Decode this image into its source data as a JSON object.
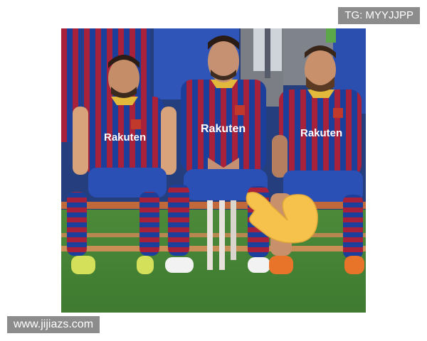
{
  "watermark_top": "TG: MYYJJPP",
  "watermark_bottom": "www.jijiazs.com",
  "sponsor": "Rakuten",
  "colors": {
    "kit_blue": "#1d3f9c",
    "kit_red": "#a8213a",
    "collar_gold": "#e2b93a",
    "shorts_blue": "#2a4fb5",
    "grass": "#4f8a3c",
    "hand_emoji": "#f6c24b"
  },
  "emoji": "pointing-hand-emoji"
}
